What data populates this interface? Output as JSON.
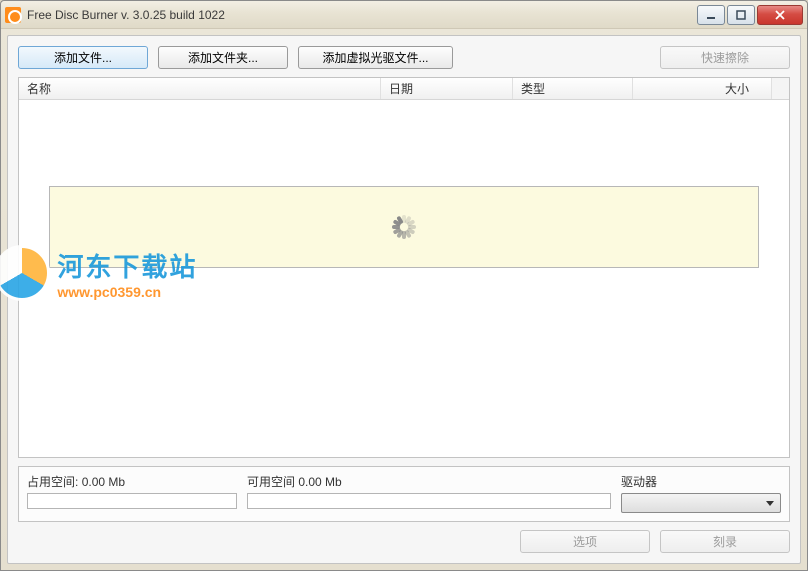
{
  "window": {
    "title": "Free Disc Burner   v. 3.0.25 build 1022"
  },
  "toolbar": {
    "add_file": "添加文件...",
    "add_folder": "添加文件夹...",
    "add_iso": "添加虚拟光驱文件...",
    "quick_erase": "快速擦除"
  },
  "columns": {
    "name": "名称",
    "date": "日期",
    "type": "类型",
    "size": "大小"
  },
  "status": {
    "used_label": "占用空间:",
    "used_value": "0.00 Mb",
    "free_label": "可用空间",
    "free_value": "0.00 Mb",
    "drive_label": "驱动器"
  },
  "footer": {
    "options": "选项",
    "burn": "刻录"
  },
  "watermark": {
    "title": "河东下载站",
    "url": "www.pc0359.cn"
  }
}
